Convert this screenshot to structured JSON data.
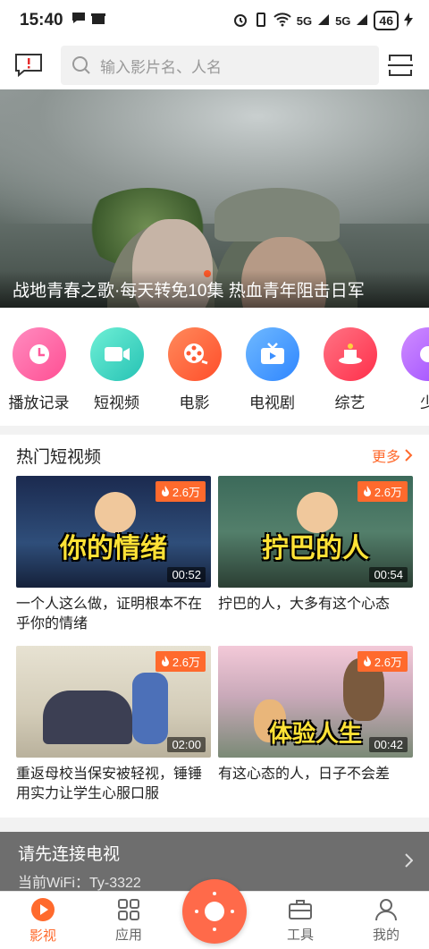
{
  "status_bar": {
    "time": "15:40",
    "network": "5G",
    "battery": "46"
  },
  "header": {
    "search_placeholder": "输入影片名、人名"
  },
  "banner": {
    "title": "战地青春之歌·每天转免10集 热血青年阻击日军"
  },
  "categories": [
    {
      "label": "播放记录",
      "color": "#ff6fa8",
      "icon": "clock-icon"
    },
    {
      "label": "短视频",
      "color": "#3fd6c0",
      "icon": "video-camera-icon"
    },
    {
      "label": "电影",
      "color": "#ff6a3d",
      "icon": "film-reel-icon"
    },
    {
      "label": "电视剧",
      "color": "#3b9bff",
      "icon": "tv-icon"
    },
    {
      "label": "综艺",
      "color": "#ff4a5e",
      "icon": "magic-hat-icon"
    },
    {
      "label": "少",
      "color": "#b86cff",
      "icon": "kid-icon"
    }
  ],
  "hot_videos": {
    "title": "热门短视频",
    "more_label": "更多",
    "items": [
      {
        "caption": "你的情绪",
        "views": "2.6万",
        "duration": "00:52",
        "desc": "一个人这么做，证明根本不在乎你的情绪"
      },
      {
        "caption": "拧巴的人",
        "views": "2.6万",
        "duration": "00:54",
        "desc": "拧巴的人，大多有这个心态"
      },
      {
        "caption": "",
        "views": "2.6万",
        "duration": "02:00",
        "desc": "重返母校当保安被轻视，锤锤用实力让学生心服口服"
      },
      {
        "caption": "体验人生",
        "views": "2.6万",
        "duration": "00:42",
        "desc": "有这心态的人，日子不会差"
      }
    ]
  },
  "tv_connect": {
    "title": "请先连接电视",
    "wifi_label": "当前WiFi：Ty-3322"
  },
  "tabs": [
    {
      "label": "影视",
      "icon": "play-circle-icon",
      "active": true
    },
    {
      "label": "应用",
      "icon": "apps-grid-icon",
      "active": false
    },
    {
      "label": "工具",
      "icon": "toolbox-icon",
      "active": false
    },
    {
      "label": "我的",
      "icon": "user-icon",
      "active": false
    }
  ],
  "colors": {
    "accent": "#ff6a2d",
    "fab": "#ff6a4a"
  }
}
